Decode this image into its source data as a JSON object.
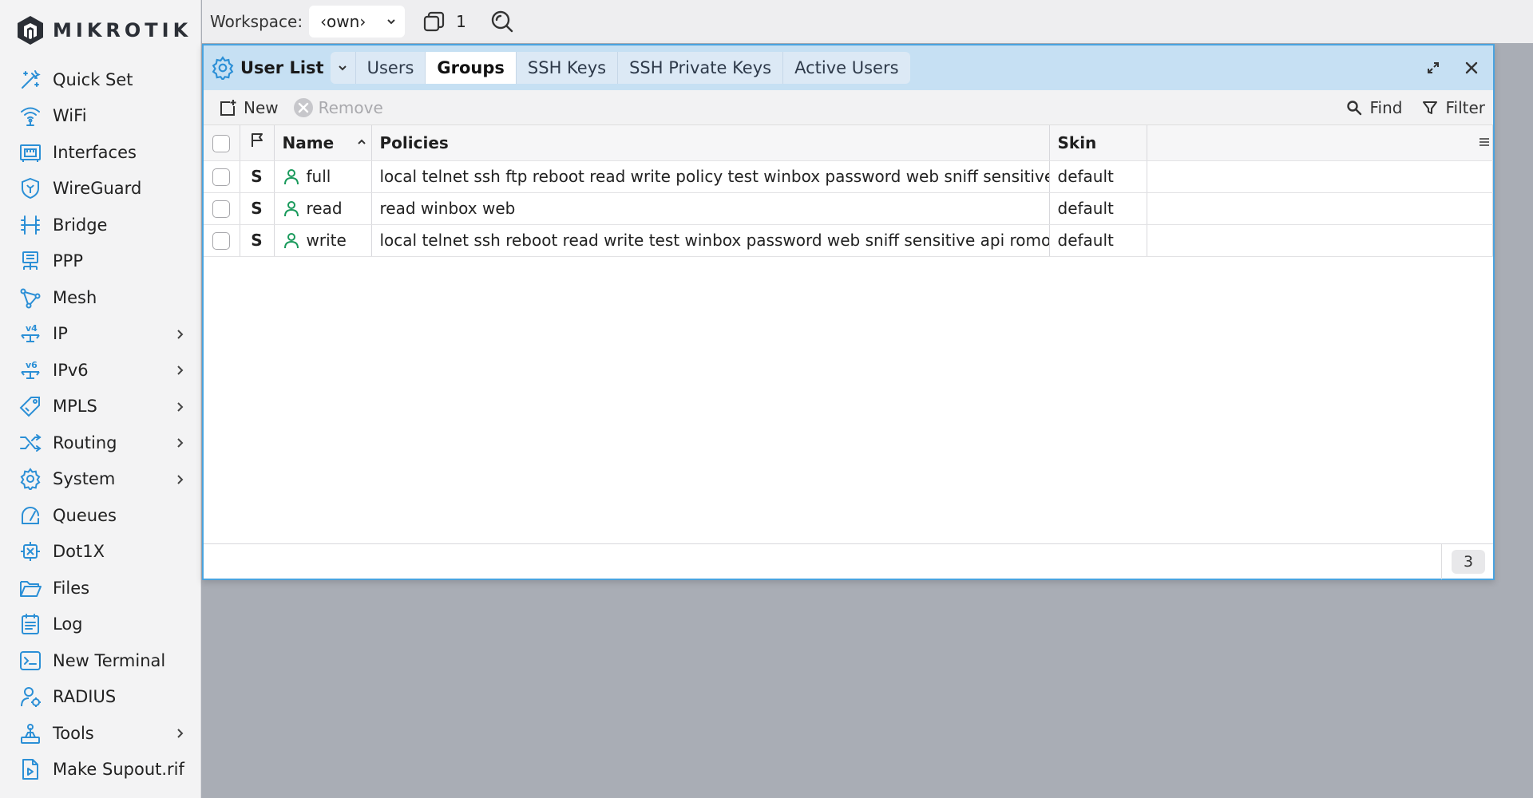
{
  "brand": {
    "name": "MIKROTIK"
  },
  "sidebar": {
    "items": [
      {
        "label": "Quick Set",
        "icon": "magic-wand-icon",
        "submenu": false
      },
      {
        "label": "WiFi",
        "icon": "wifi-icon",
        "submenu": false
      },
      {
        "label": "Interfaces",
        "icon": "interfaces-icon",
        "submenu": false
      },
      {
        "label": "WireGuard",
        "icon": "wireguard-shield-icon",
        "submenu": false
      },
      {
        "label": "Bridge",
        "icon": "bridge-icon",
        "submenu": false
      },
      {
        "label": "PPP",
        "icon": "ppp-icon",
        "submenu": false
      },
      {
        "label": "Mesh",
        "icon": "mesh-icon",
        "submenu": false
      },
      {
        "label": "IP",
        "icon": "ipv4-icon",
        "submenu": true
      },
      {
        "label": "IPv6",
        "icon": "ipv6-icon",
        "submenu": true
      },
      {
        "label": "MPLS",
        "icon": "mpls-tag-icon",
        "submenu": true
      },
      {
        "label": "Routing",
        "icon": "routing-icon",
        "submenu": true
      },
      {
        "label": "System",
        "icon": "system-gear-icon",
        "submenu": true
      },
      {
        "label": "Queues",
        "icon": "queues-gauge-icon",
        "submenu": false
      },
      {
        "label": "Dot1X",
        "icon": "dot1x-icon",
        "submenu": false
      },
      {
        "label": "Files",
        "icon": "folder-icon",
        "submenu": false
      },
      {
        "label": "Log",
        "icon": "log-icon",
        "submenu": false
      },
      {
        "label": "New Terminal",
        "icon": "terminal-icon",
        "submenu": false
      },
      {
        "label": "RADIUS",
        "icon": "radius-icon",
        "submenu": false
      },
      {
        "label": "Tools",
        "icon": "tools-icon",
        "submenu": true
      },
      {
        "label": "Make Supout.rif",
        "icon": "supout-file-icon",
        "submenu": false
      }
    ]
  },
  "topbar": {
    "workspace_label": "Workspace:",
    "workspace_value": "‹own›",
    "window_count": "1"
  },
  "window": {
    "title": "User List",
    "tabs": [
      {
        "label": "Users",
        "active": false
      },
      {
        "label": "Groups",
        "active": true
      },
      {
        "label": "SSH Keys",
        "active": false
      },
      {
        "label": "SSH Private Keys",
        "active": false
      },
      {
        "label": "Active Users",
        "active": false
      }
    ],
    "toolbar": {
      "new_label": "New",
      "remove_label": "Remove",
      "find_label": "Find",
      "filter_label": "Filter"
    },
    "table": {
      "columns": {
        "name": "Name",
        "policies": "Policies",
        "skin": "Skin"
      },
      "rows": [
        {
          "flag": "S",
          "name": "full",
          "policies": "local telnet ssh ftp reboot read write policy test winbox password web sniff sensitive api romon rest-api",
          "skin": "default"
        },
        {
          "flag": "S",
          "name": "read",
          "policies": "read winbox web",
          "skin": "default"
        },
        {
          "flag": "S",
          "name": "write",
          "policies": "local telnet ssh reboot read write test winbox password web sniff sensitive api romon rest-api",
          "skin": "default"
        }
      ]
    },
    "footer": {
      "count": "3"
    }
  },
  "colors": {
    "accent": "#2b8fd6",
    "titlebar": "#c6e0f3",
    "user_icon": "#1a9a5c",
    "sidebar_bg": "#f3f3f4",
    "desktop_bg": "#a9adb5"
  }
}
